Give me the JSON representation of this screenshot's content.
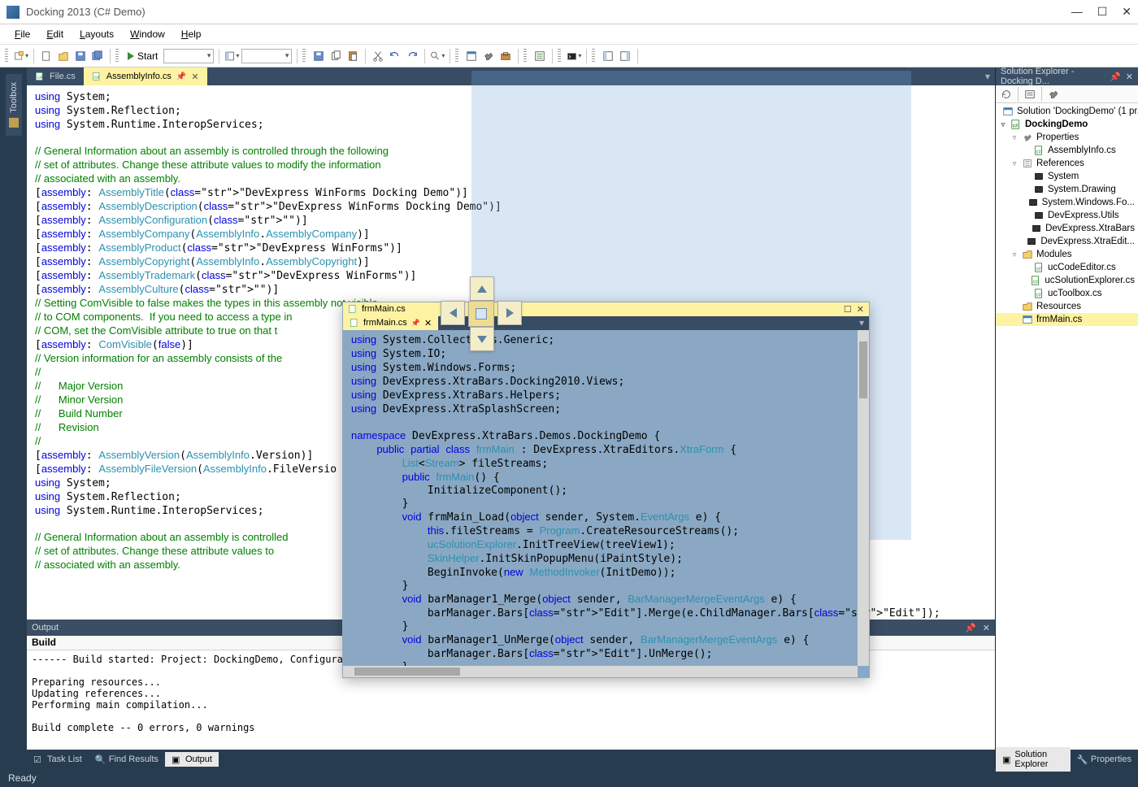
{
  "titlebar": {
    "title": "Docking 2013 (C# Demo)"
  },
  "menubar": [
    "File",
    "Edit",
    "Layouts",
    "Window",
    "Help"
  ],
  "toolbar": {
    "start_label": "Start"
  },
  "doc_tabs": [
    {
      "label": "File.cs",
      "active": false
    },
    {
      "label": "AssemblyInfo.cs",
      "active": true
    }
  ],
  "assembly_info_code": "using System;\nusing System.Reflection;\nusing System.Runtime.InteropServices;\n\n// General Information about an assembly is controlled through the following\n// set of attributes. Change these attribute values to modify the information\n// associated with an assembly.\n[assembly: AssemblyTitle(\"DevExpress WinForms Docking Demo\")]\n[assembly: AssemblyDescription(\"DevExpress WinForms Docking Demo\")]\n[assembly: AssemblyConfiguration(\"\")]\n[assembly: AssemblyCompany(AssemblyInfo.AssemblyCompany)]\n[assembly: AssemblyProduct(\"DevExpress WinForms\")]\n[assembly: AssemblyCopyright(AssemblyInfo.AssemblyCopyright)]\n[assembly: AssemblyTrademark(\"DevExpress WinForms\")]\n[assembly: AssemblyCulture(\"\")]\n// Setting ComVisible to false makes the types in this assembly not visible\n// to COM components.  If you need to access a type in\n// COM, set the ComVisible attribute to true on that t\n[assembly: ComVisible(false)]\n// Version information for an assembly consists of the\n//\n//      Major Version\n//      Minor Version\n//      Build Number\n//      Revision\n//\n[assembly: AssemblyVersion(AssemblyInfo.Version)]\n[assembly: AssemblyFileVersion(AssemblyInfo.FileVersio\nusing System;\nusing System.Reflection;\nusing System.Runtime.InteropServices;\n\n// General Information about an assembly is controlled\n// set of attributes. Change these attribute values to\n// associated with an assembly.",
  "float": {
    "title": "frmMain.cs",
    "tab": "frmMain.cs",
    "code": "using System.Collections.Generic;\nusing System.IO;\nusing System.Windows.Forms;\nusing DevExpress.XtraBars.Docking2010.Views;\nusing DevExpress.XtraBars.Helpers;\nusing DevExpress.XtraSplashScreen;\n\nnamespace DevExpress.XtraBars.Demos.DockingDemo {\n    public partial class frmMain : DevExpress.XtraEditors.XtraForm {\n        List<Stream> fileStreams;\n        public frmMain() {\n            InitializeComponent();\n        }\n        void frmMain_Load(object sender, System.EventArgs e) {\n            this.fileStreams = Program.CreateResourceStreams();\n            ucSolutionExplorer.InitTreeView(treeView1);\n            SkinHelper.InitSkinPopupMenu(iPaintStyle);\n            BeginInvoke(new MethodInvoker(InitDemo));\n        }\n        void barManager1_Merge(object sender, BarManagerMergeEventArgs e) {\n            barManager.Bars[\"Edit\"].Merge(e.ChildManager.Bars[\"Edit\"]);\n        }\n        void barManager1_UnMerge(object sender, BarManagerMergeEventArgs e) {\n            barManager.Bars[\"Edit\"].UnMerge();\n        }"
  },
  "output": {
    "title": "Output",
    "subtitle": "Build",
    "body": "------ Build started: Project: DockingDemo, Configurati\n\nPreparing resources...\nUpdating references...\nPerforming main compilation...\n\nBuild complete -- 0 errors, 0 warnings"
  },
  "output_tabs": [
    {
      "label": "Task List",
      "active": false
    },
    {
      "label": "Find Results",
      "active": false
    },
    {
      "label": "Output",
      "active": true
    }
  ],
  "solution_explorer": {
    "title": "Solution Explorer - Docking D...",
    "tree": [
      {
        "depth": 1,
        "twist": "",
        "icon": "solution",
        "label": "Solution 'DockingDemo' (1 pr..."
      },
      {
        "depth": 1,
        "twist": "▿",
        "icon": "project",
        "label": "DockingDemo",
        "bold": true
      },
      {
        "depth": 2,
        "twist": "▿",
        "icon": "wrench",
        "label": "Properties"
      },
      {
        "depth": 3,
        "twist": "",
        "icon": "cs",
        "label": "AssemblyInfo.cs"
      },
      {
        "depth": 2,
        "twist": "▿",
        "icon": "refs",
        "label": "References"
      },
      {
        "depth": 3,
        "twist": "",
        "icon": "ref",
        "label": "System"
      },
      {
        "depth": 3,
        "twist": "",
        "icon": "ref",
        "label": "System.Drawing"
      },
      {
        "depth": 3,
        "twist": "",
        "icon": "ref",
        "label": "System.Windows.Fo..."
      },
      {
        "depth": 3,
        "twist": "",
        "icon": "ref",
        "label": "DevExpress.Utils"
      },
      {
        "depth": 3,
        "twist": "",
        "icon": "ref",
        "label": "DevExpress.XtraBars"
      },
      {
        "depth": 3,
        "twist": "",
        "icon": "ref",
        "label": "DevExpress.XtraEdit..."
      },
      {
        "depth": 2,
        "twist": "▿",
        "icon": "folder",
        "label": "Modules"
      },
      {
        "depth": 3,
        "twist": "",
        "icon": "cs",
        "label": "ucCodeEditor.cs"
      },
      {
        "depth": 3,
        "twist": "",
        "icon": "cs",
        "label": "ucSolutionExplorer.cs"
      },
      {
        "depth": 3,
        "twist": "",
        "icon": "cs",
        "label": "ucToolbox.cs"
      },
      {
        "depth": 2,
        "twist": "",
        "icon": "folder",
        "label": "Resources"
      },
      {
        "depth": 2,
        "twist": "",
        "icon": "form",
        "label": "frmMain.cs",
        "sel": true
      }
    ]
  },
  "right_tabs": [
    {
      "label": "Solution Explorer",
      "active": true
    },
    {
      "label": "Properties",
      "active": false
    }
  ],
  "toolbox": {
    "label": "Toolbox"
  },
  "status": {
    "text": "Ready"
  }
}
